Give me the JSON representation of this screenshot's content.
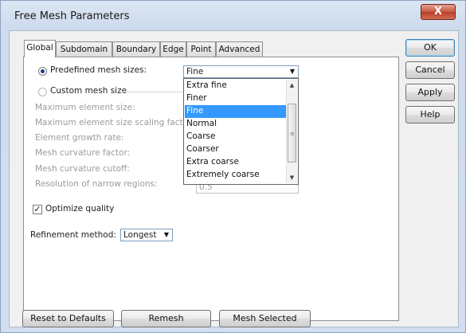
{
  "window": {
    "title": "Free Mesh Parameters",
    "close_glyph": "X"
  },
  "tabs": [
    {
      "label": "Global",
      "active": true
    },
    {
      "label": "Subdomain"
    },
    {
      "label": "Boundary"
    },
    {
      "label": "Edge"
    },
    {
      "label": "Point"
    },
    {
      "label": "Advanced"
    }
  ],
  "global": {
    "predefined_label": "Predefined mesh sizes:",
    "predefined_value": "Fine",
    "custom_label": "Custom mesh size",
    "params": [
      {
        "label": "Maximum element size:"
      },
      {
        "label": "Maximum element size scaling facto"
      },
      {
        "label": "Element growth rate:"
      },
      {
        "label": "Mesh curvature factor:"
      },
      {
        "label": "Mesh curvature cutoff:"
      },
      {
        "label": "Resolution of narrow regions:",
        "value": "0.5"
      }
    ],
    "dropdown_options": [
      "Extra fine",
      "Finer",
      "Fine",
      "Normal",
      "Coarse",
      "Coarser",
      "Extra coarse",
      "Extremely coarse"
    ],
    "dropdown_selected": "Fine",
    "optimize_label": "Optimize quality",
    "optimize_checked": true,
    "refinement_label": "Refinement method:",
    "refinement_value": "Longest"
  },
  "side_buttons": {
    "ok": "OK",
    "cancel": "Cancel",
    "apply": "Apply",
    "help": "Help"
  },
  "bottom_buttons": {
    "reset": "Reset to Defaults",
    "remesh": "Remesh",
    "mesh_selected": "Mesh Selected"
  },
  "colors": {
    "selection": "#3399ff",
    "close_button": "#c85b45",
    "frame": "#cfdcee"
  }
}
